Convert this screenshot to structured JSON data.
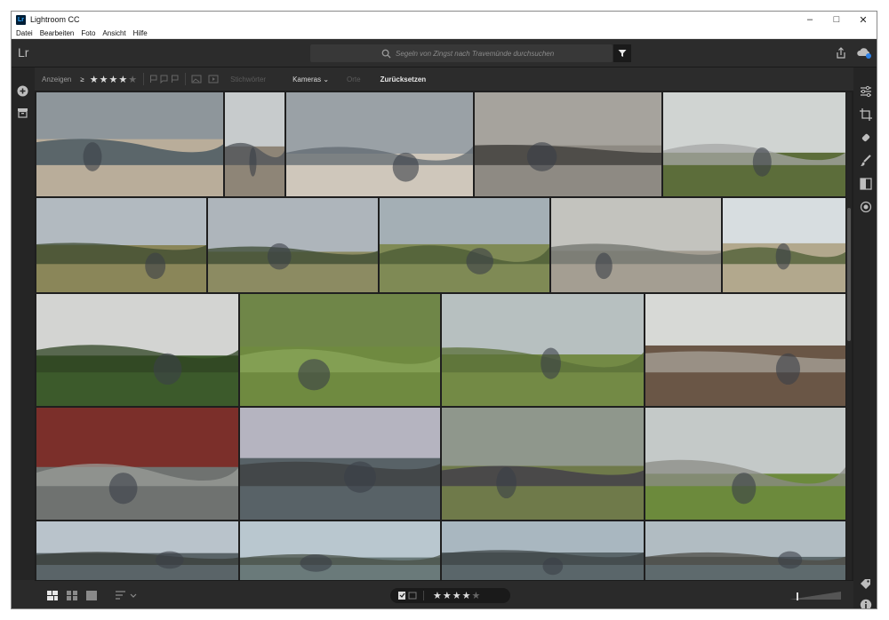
{
  "window": {
    "title": "Lightroom CC",
    "app_icon": "Lr",
    "controls": [
      "minimize-icon",
      "maximize-icon",
      "close-icon"
    ]
  },
  "menu": [
    "Datei",
    "Bearbeiten",
    "Foto",
    "Ansicht",
    "Hilfe"
  ],
  "topbar": {
    "logo": "Lr",
    "search_placeholder": "Segeln von Zingst nach Travemünde durchsuchen"
  },
  "filterbar": {
    "show_label": "Anzeigen",
    "op": "≥",
    "rating_stars": 4,
    "keywords": "Stichwörter",
    "cameras": "Kameras",
    "places": "Orte",
    "reset": "Zurücksetzen"
  },
  "bottombar": {
    "rating_stars": 4
  },
  "photos": [
    {
      "sky": "#8e969b",
      "ground": "#b9ad9a",
      "mid": "#3c4f5a"
    },
    {
      "sky": "#c7cbcc",
      "ground": "#8e8577",
      "mid": "#4d5358"
    },
    {
      "sky": "#9aa1a6",
      "ground": "#cfc7bb",
      "mid": "#606a70"
    },
    {
      "sky": "#a6a39d",
      "ground": "#8e8a83",
      "mid": "#3a3835"
    },
    {
      "sky": "#d0d4d2",
      "ground": "#5c6d3a",
      "mid": "#a5a7a6"
    },
    {
      "sky": "#b2bac0",
      "ground": "#8a8659",
      "mid": "#3c4a2f"
    },
    {
      "sky": "#aeb5bb",
      "ground": "#8c8b62",
      "mid": "#3b4a31"
    },
    {
      "sky": "#a4afb5",
      "ground": "#7f8a55",
      "mid": "#4a5a34"
    },
    {
      "sky": "#c3c3be",
      "ground": "#a49e92",
      "mid": "#70736c"
    },
    {
      "sky": "#d7dde0",
      "ground": "#b2a88d",
      "mid": "#4b5c33"
    },
    {
      "sky": "#d3d4d2",
      "ground": "#3c5a2b",
      "mid": "#2f4423"
    },
    {
      "sky": "#6f8648",
      "ground": "#6f8a40",
      "mid": "#8aa65a"
    },
    {
      "sky": "#b7c0c0",
      "ground": "#738a45",
      "mid": "#5a6f38"
    },
    {
      "sky": "#d7d9d6",
      "ground": "#6a5646",
      "mid": "#a9a49b"
    },
    {
      "sky": "#7b2f2a",
      "ground": "#6f7270",
      "mid": "#9a9d98"
    },
    {
      "sky": "#b5b4c0",
      "ground": "#586267",
      "mid": "#3c3f3f"
    },
    {
      "sky": "#8f978c",
      "ground": "#6f7a4a",
      "mid": "#3d3a4a"
    },
    {
      "sky": "#c4c9c8",
      "ground": "#6c8a3c",
      "mid": "#8b8b86"
    },
    {
      "sky": "#b9c3cb",
      "ground": "#5a6468",
      "mid": "#3a3d3a"
    },
    {
      "sky": "#b9c7cf",
      "ground": "#6a7a7a",
      "mid": "#4a5248"
    },
    {
      "sky": "#a9b7c0",
      "ground": "#5a666a",
      "mid": "#3f4547"
    },
    {
      "sky": "#b1bcc2",
      "ground": "#5e6a6d",
      "mid": "#4d4c45"
    }
  ]
}
